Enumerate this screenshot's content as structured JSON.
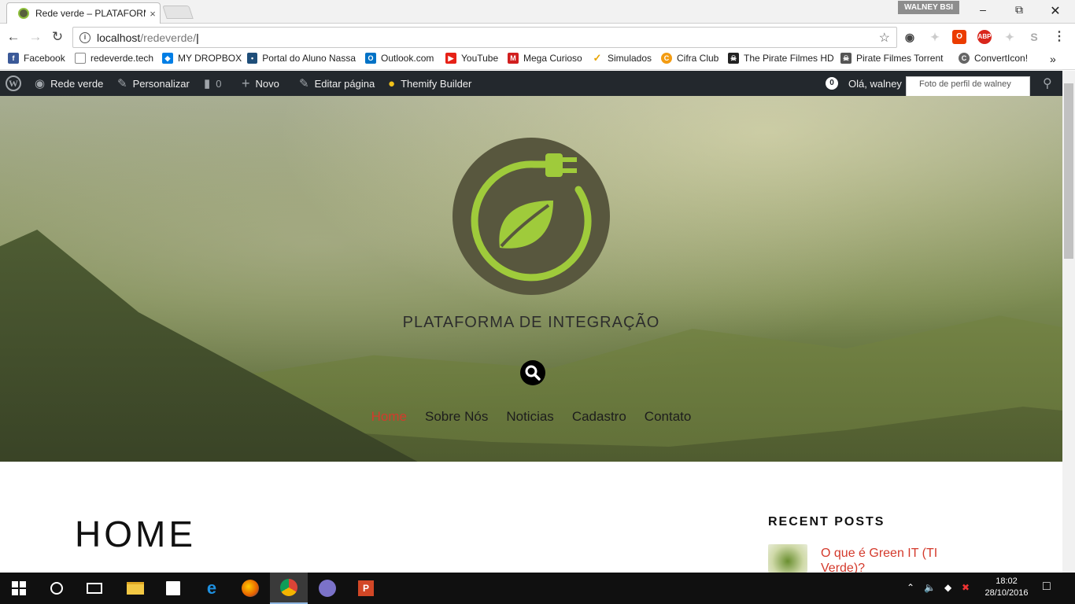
{
  "browser": {
    "tab_title": "Rede verde – PLATAFORMA DE INTEGRAÇÃO",
    "tab_close": "×",
    "profile_name": "WALNEY BSI",
    "url_host": "localhost",
    "url_path": "/redeverde/"
  },
  "bookmarks": [
    {
      "label": "Facebook",
      "icon": "facebook-icon",
      "color": "#3b5998"
    },
    {
      "label": "redeverde.tech",
      "icon": "page-icon",
      "color": "#888888"
    },
    {
      "label": "MY DROPBOX",
      "icon": "dropbox-icon",
      "color": "#007ee5"
    },
    {
      "label": "Portal do Aluno Nassa",
      "icon": "portal-icon",
      "color": "#1f4e79"
    },
    {
      "label": "Outlook.com",
      "icon": "outlook-icon",
      "color": "#0072c6"
    },
    {
      "label": "YouTube",
      "icon": "youtube-icon",
      "color": "#e62117"
    },
    {
      "label": "Mega Curioso",
      "icon": "mega-curioso-icon",
      "color": "#d11f1f"
    },
    {
      "label": "Simulados",
      "icon": "check-icon",
      "color": "#e8a400"
    },
    {
      "label": "Cifra Club",
      "icon": "cifra-icon",
      "color": "#f39c12"
    },
    {
      "label": "The Pirate Filmes HD",
      "icon": "pirate-icon",
      "color": "#222222"
    },
    {
      "label": "Pirate Filmes Torrent",
      "icon": "pirate-ship-icon",
      "color": "#555555"
    },
    {
      "label": "ConvertIcon!",
      "icon": "convert-icon",
      "color": "#666666"
    }
  ],
  "bookmarks_overflow": "»",
  "adminbar": {
    "site_name": "Rede verde",
    "customize": "Personalizar",
    "comments_count": "0",
    "new": "Novo",
    "edit_page": "Editar página",
    "builder": "Themify Builder",
    "notif_count": "0",
    "greeting": "Olá, walney",
    "avatar_alt": "Foto de perfil de walney"
  },
  "site": {
    "description": "PLATAFORMA DE INTEGRAÇÃO",
    "menu": [
      "Home",
      "Sobre Nós",
      "Noticias",
      "Cadastro",
      "Contato"
    ],
    "active_menu": "Home",
    "accent_color": "#d43a2c",
    "logo_ring_color": "#9fcb3b",
    "logo_bg_color": "#58573e"
  },
  "content": {
    "page_title": "HOME",
    "recent_posts_heading": "RECENT POSTS",
    "recent_posts": [
      {
        "title": "O que é Green IT (TI Verde)?"
      }
    ]
  },
  "taskbar": {
    "apps": [
      "start",
      "search",
      "task-view",
      "file-explorer",
      "store",
      "edge",
      "firefox",
      "chrome",
      "torrent",
      "powerpoint"
    ],
    "active_app": "chrome",
    "time": "18:02",
    "date": "28/10/2016"
  }
}
